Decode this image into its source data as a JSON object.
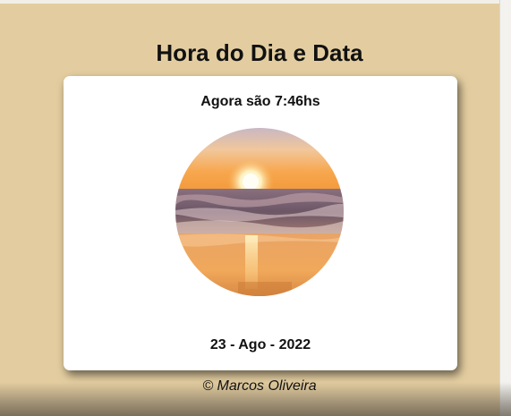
{
  "header": {
    "title": "Hora do Dia e Data"
  },
  "card": {
    "time_text": "Agora são 7:46hs",
    "image_icon": "sunrise-beach-photo",
    "date_text": "23 - Ago - 2022"
  },
  "footer": {
    "text": "© Marcos Oliveira"
  },
  "colors": {
    "background": "#e3cda0",
    "card": "#ffffff",
    "text": "#111111"
  }
}
